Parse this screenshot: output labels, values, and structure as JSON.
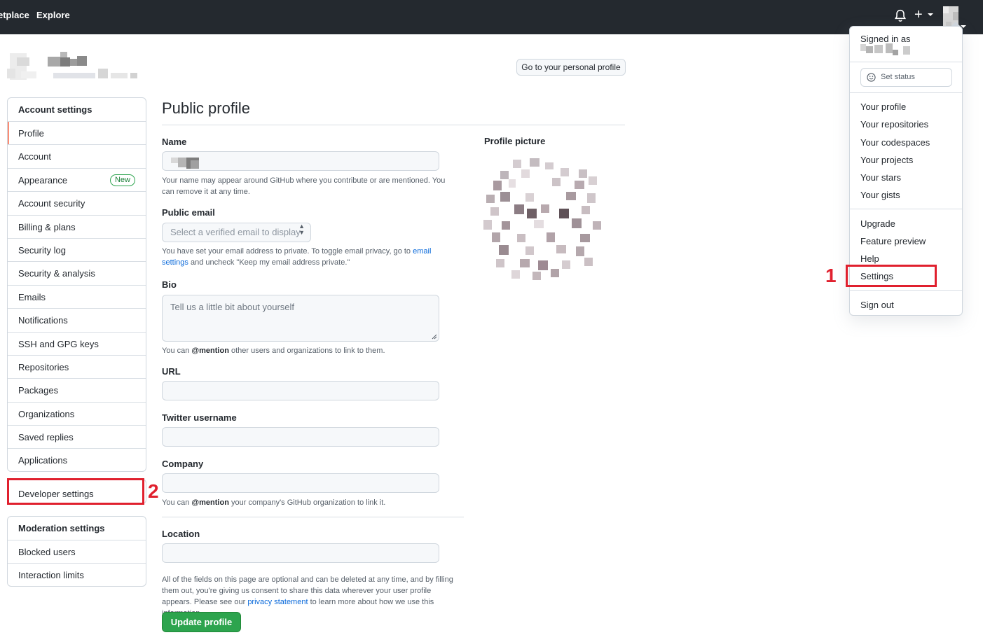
{
  "header": {
    "nav": [
      "etplace",
      "Explore"
    ],
    "icons": [
      "bell-icon",
      "plus-icon",
      "avatar"
    ]
  },
  "user_header": {
    "personal_profile_button": "Go to your personal profile"
  },
  "sidebar": {
    "account_heading": "Account settings",
    "items": [
      {
        "label": "Profile",
        "selected": true
      },
      {
        "label": "Account"
      },
      {
        "label": "Appearance",
        "badge": "New"
      },
      {
        "label": "Account security"
      },
      {
        "label": "Billing & plans"
      },
      {
        "label": "Security log"
      },
      {
        "label": "Security & analysis"
      },
      {
        "label": "Emails"
      },
      {
        "label": "Notifications"
      },
      {
        "label": "SSH and GPG keys"
      },
      {
        "label": "Repositories"
      },
      {
        "label": "Packages"
      },
      {
        "label": "Organizations"
      },
      {
        "label": "Saved replies"
      },
      {
        "label": "Applications"
      }
    ],
    "developer_settings": "Developer settings",
    "moderation_heading": "Moderation settings",
    "moderation_items": [
      {
        "label": "Blocked users"
      },
      {
        "label": "Interaction limits"
      }
    ]
  },
  "main": {
    "title": "Public profile",
    "name_label": "Name",
    "name_note": "Your name may appear around GitHub where you contribute or are mentioned. You can remove it at any time.",
    "email_label": "Public email",
    "email_select": "Select a verified email to display",
    "email_note_before": "You have set your email address to private. To toggle email privacy, go to ",
    "email_note_link": "email settings",
    "email_note_after": " and uncheck \"Keep my email address private.\"",
    "bio_label": "Bio",
    "bio_placeholder": "Tell us a little bit about yourself",
    "bio_note_before": "You can ",
    "bio_note_strong": "@mention",
    "bio_note_after": " other users and organizations to link to them.",
    "url_label": "URL",
    "twitter_label": "Twitter username",
    "company_label": "Company",
    "company_note_before": "You can ",
    "company_note_strong": "@mention",
    "company_note_after": " your company's GitHub organization to link it.",
    "location_label": "Location",
    "footer_note_before": "All of the fields on this page are optional and can be deleted at any time, and by filling them out, you're giving us consent to share this data wherever your user profile appears. Please see our ",
    "footer_note_link": "privacy statement",
    "footer_note_after": " to learn more about how we use this information.",
    "update_button": "Update profile",
    "profile_picture_label": "Profile picture"
  },
  "dropdown": {
    "signed_in_as": "Signed in as",
    "set_status": "Set status",
    "group1": [
      "Your profile",
      "Your repositories",
      "Your codespaces",
      "Your projects",
      "Your stars",
      "Your gists"
    ],
    "group2": [
      "Upgrade",
      "Feature preview",
      "Help",
      "Settings"
    ],
    "sign_out": "Sign out"
  },
  "annotations": {
    "marker_1": "1",
    "marker_2": "2",
    "color": "#e0202e"
  }
}
